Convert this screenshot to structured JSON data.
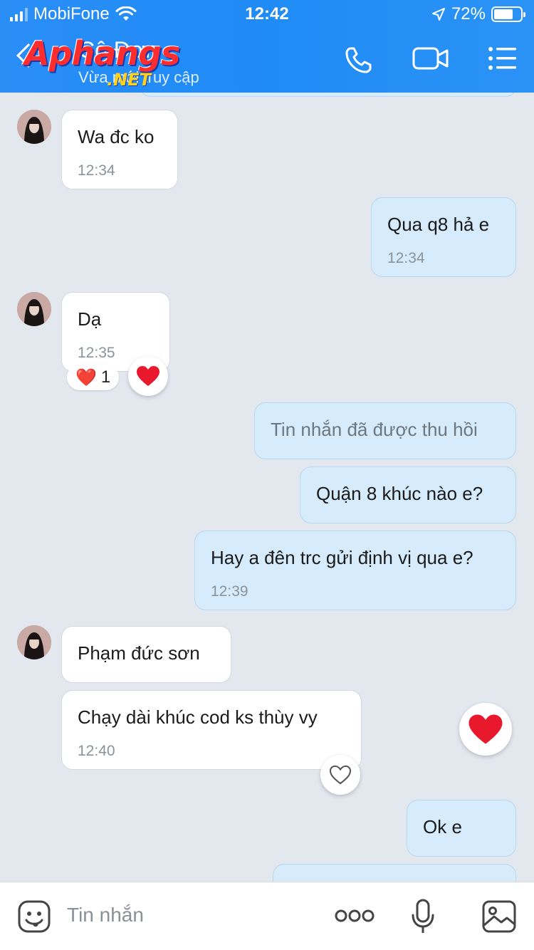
{
  "status_bar": {
    "carrier": "MobiFone",
    "time": "12:42",
    "battery": "72%",
    "battery_level": 0.72
  },
  "header": {
    "title": "Cô Đơn",
    "subtitle": "Vừa mới truy cập",
    "watermark": "Aphangs",
    "watermark_suffix": ".NET"
  },
  "messages": [
    {
      "from": "them",
      "text": "Wa đc ko",
      "time": "12:34"
    },
    {
      "from": "me",
      "text": "Qua q8 hả e",
      "time": "12:34"
    },
    {
      "from": "them",
      "text": "Dạ",
      "time": "12:35",
      "reaction": {
        "emoji": "❤️",
        "count": "1"
      }
    },
    {
      "from": "me",
      "text": "Tin nhắn đã được thu hồi",
      "recalled": true
    },
    {
      "from": "me",
      "text": "Quận 8 khúc nào e?"
    },
    {
      "from": "me",
      "text": "Hay a đên trc gửi định vị qua e?",
      "time": "12:39"
    },
    {
      "from": "them",
      "text": "Phạm đức sơn"
    },
    {
      "from": "them",
      "text": "Chạy dài khúc cod ks thùy vy",
      "time": "12:40"
    },
    {
      "from": "me",
      "text": "Ok e"
    }
  ],
  "input": {
    "placeholder": "Tin nhắn"
  },
  "colors": {
    "header": "#1f8bf5",
    "chat_background": "#e3e8ef",
    "outgoing_bubble": "#d6ebfb",
    "incoming_bubble": "#ffffff",
    "heart": "#e8192c"
  }
}
